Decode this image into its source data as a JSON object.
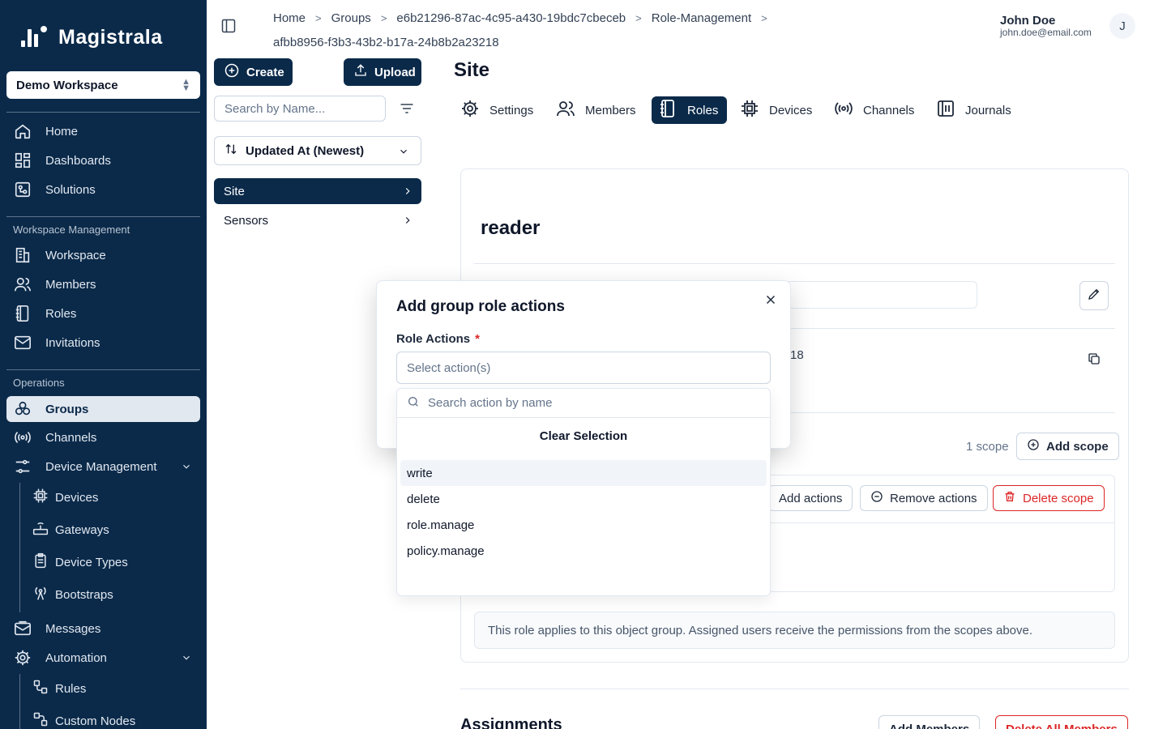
{
  "sidebar": {
    "brand": "Magistrala",
    "workspace": "Demo Workspace",
    "sections": {
      "workspace_management": "Workspace Management",
      "operations": "Operations"
    },
    "items": {
      "home": "Home",
      "dashboards": "Dashboards",
      "solutions": "Solutions",
      "workspace": "Workspace",
      "members": "Members",
      "roles": "Roles",
      "invitations": "Invitations",
      "groups": "Groups",
      "channels": "Channels",
      "device_management": "Device Management",
      "devices": "Devices",
      "gateways": "Gateways",
      "device_types": "Device Types",
      "bootstraps": "Bootstraps",
      "messages": "Messages",
      "automation": "Automation",
      "rules": "Rules",
      "custom_nodes": "Custom Nodes"
    }
  },
  "header": {
    "breadcrumb": [
      "Home",
      "Groups",
      "e6b21296-87ac-4c95-a430-19bdc7cbeceb",
      "Role-Management",
      "afbb8956-f3b3-43b2-b17a-24b8b2a23218"
    ],
    "user_name": "John Doe",
    "user_email": "john.doe@email.com",
    "avatar_initial": "J"
  },
  "list": {
    "create_label": "Create",
    "upload_label": "Upload",
    "search_placeholder": "Search by Name...",
    "sort_label": "Updated At (Newest)",
    "items": [
      "Site",
      "Sensors"
    ]
  },
  "main": {
    "title": "Site",
    "tabs": [
      "Settings",
      "Members",
      "Roles",
      "Devices",
      "Channels",
      "Journals"
    ],
    "active_tab": "Roles",
    "role_name": "reader",
    "id_tail": "18",
    "scope_count": "1 scope",
    "add_scope": "Add scope",
    "add_actions": "Add actions",
    "remove_actions": "Remove actions",
    "delete_scope": "Delete scope",
    "info_text": "This role applies to this object group. Assigned users receive the permissions from the scopes above.",
    "assignments_title": "Assignments",
    "add_members": "Add Members",
    "delete_all_members": "Delete All Members"
  },
  "modal": {
    "title": "Add group role actions",
    "field_label": "Role Actions",
    "required_mark": "*",
    "select_placeholder": "Select action(s)",
    "search_placeholder": "Search action by name",
    "clear_selection": "Clear Selection",
    "options": [
      "write",
      "delete",
      "role.manage",
      "policy.manage"
    ]
  },
  "colors": {
    "primary": "#0b2a4a",
    "danger": "#dc2626",
    "border": "#cbd5e1"
  }
}
